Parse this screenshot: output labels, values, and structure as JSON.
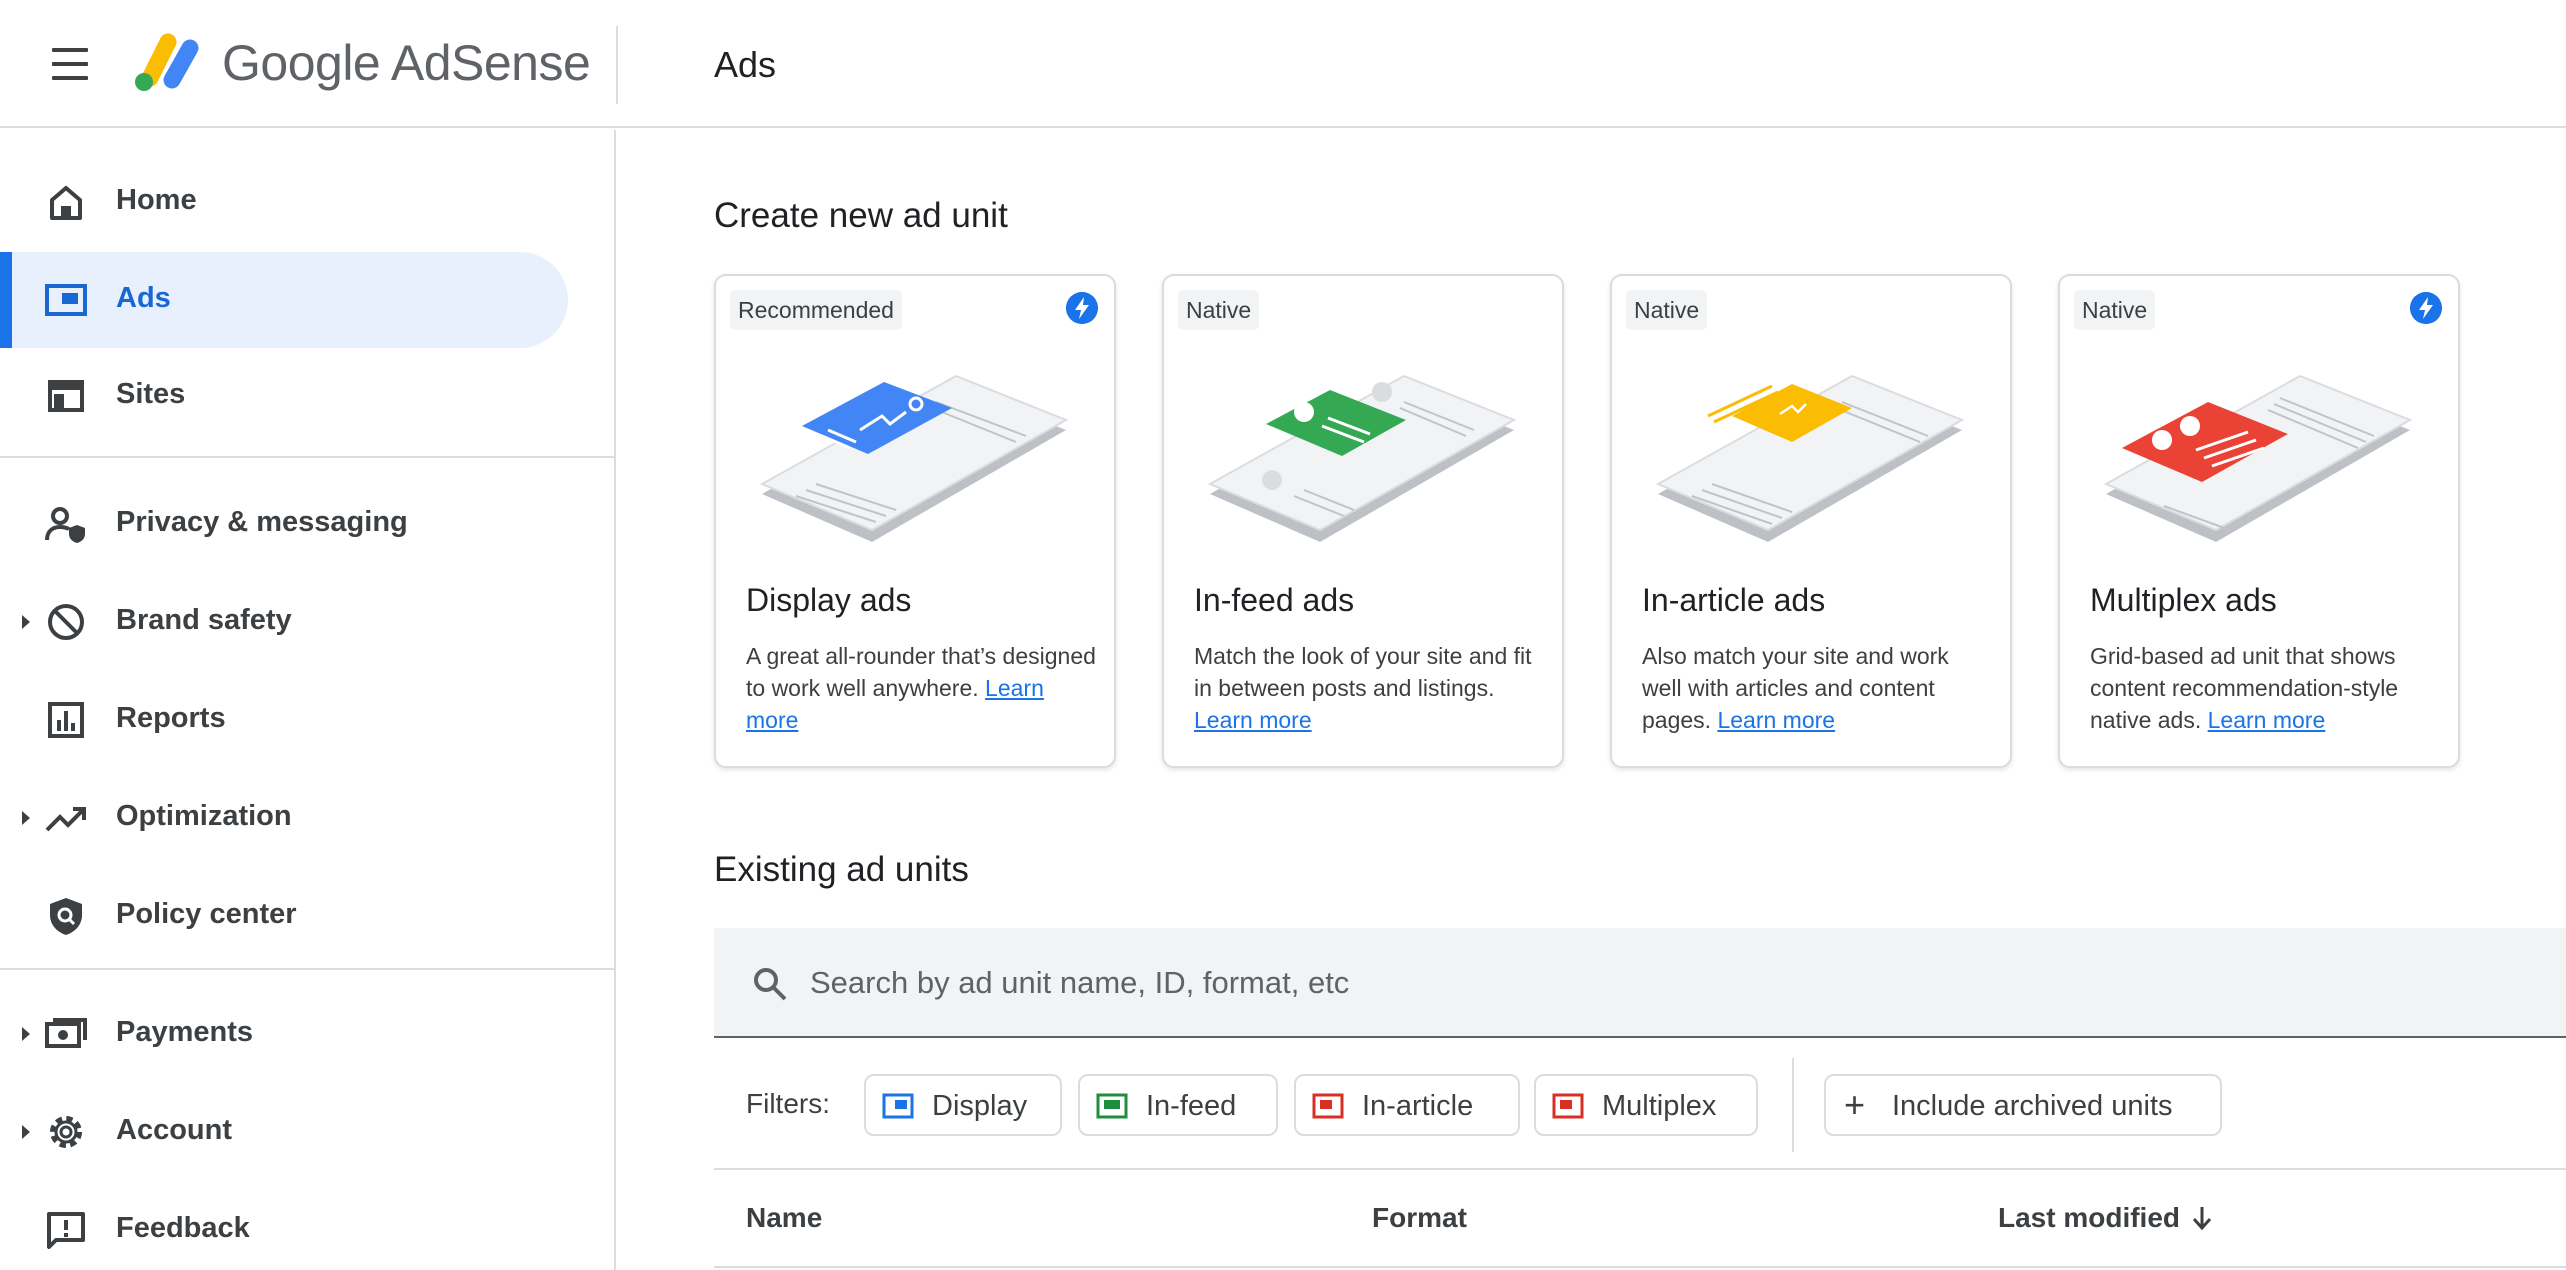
{
  "header": {
    "logo_text": "Google AdSense",
    "page_title": "Ads"
  },
  "sidebar": {
    "items": [
      {
        "label": "Home",
        "icon": "home-icon"
      },
      {
        "label": "Ads",
        "icon": "ads-icon",
        "active": true
      },
      {
        "label": "Sites",
        "icon": "sites-icon"
      },
      {
        "label": "Privacy & messaging",
        "icon": "privacy-icon"
      },
      {
        "label": "Brand safety",
        "icon": "block-icon",
        "expandable": true
      },
      {
        "label": "Reports",
        "icon": "reports-icon"
      },
      {
        "label": "Optimization",
        "icon": "trending-icon",
        "expandable": true
      },
      {
        "label": "Policy center",
        "icon": "policy-icon"
      },
      {
        "label": "Payments",
        "icon": "payments-icon",
        "expandable": true
      },
      {
        "label": "Account",
        "icon": "gear-icon",
        "expandable": true
      },
      {
        "label": "Feedback",
        "icon": "feedback-icon"
      }
    ]
  },
  "create_section": {
    "title": "Create new ad unit",
    "cards": [
      {
        "chip": "Recommended",
        "bolt": true,
        "title": "Display ads",
        "description": "A great all-rounder that’s designed to work well anywhere.",
        "link": "Learn more",
        "accent": "#4285f4"
      },
      {
        "chip": "Native",
        "bolt": false,
        "title": "In-feed ads",
        "description": "Match the look of your site and fit in between posts and listings.",
        "link": "Learn more",
        "accent": "#34a853"
      },
      {
        "chip": "Native",
        "bolt": false,
        "title": "In-article ads",
        "description": "Also match your site and work well with articles and content pages.",
        "link": "Learn more",
        "accent": "#fbbc04"
      },
      {
        "chip": "Native",
        "bolt": true,
        "title": "Multiplex ads",
        "description": "Grid-based ad unit that shows content recommendation-style native ads.",
        "link": "Learn more",
        "accent": "#ea4335"
      }
    ]
  },
  "existing_section": {
    "title": "Existing ad units",
    "search_placeholder": "Search by ad unit name, ID, format, etc",
    "filters_label": "Filters:",
    "filters": [
      {
        "label": "Display",
        "color": "#1a73e8"
      },
      {
        "label": "In-feed",
        "color": "#1e8e3e"
      },
      {
        "label": "In-article",
        "color": "#d93025"
      },
      {
        "label": "Multiplex",
        "color": "#d93025"
      }
    ],
    "archived_label": "Include archived units",
    "columns": [
      "Name",
      "Format",
      "Last modified"
    ]
  }
}
